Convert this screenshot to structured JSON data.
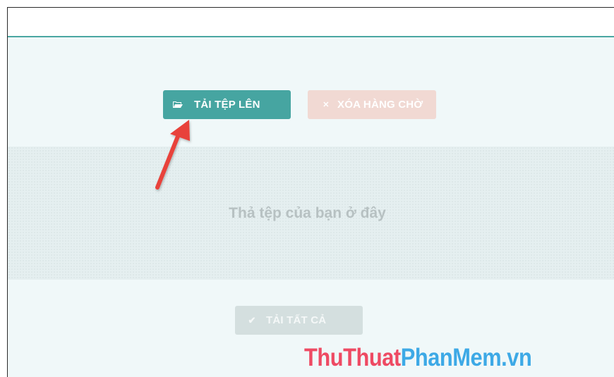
{
  "toolbar": {
    "upload_label": "TẢI TỆP LÊN",
    "clear_label": "XÓA HÀNG CHỜ",
    "clear_icon": "✕",
    "upload_icon": "folder-open-icon"
  },
  "dropzone": {
    "text": "Thả tệp của bạn ở đây"
  },
  "footer": {
    "upload_all_label": "TẢI TẤT CẢ",
    "upload_all_icon": "✔"
  },
  "watermark": {
    "part1": "ThuThuat",
    "part2": "PhanMem.vn"
  },
  "colors": {
    "accent": "#46a5a1",
    "arrow": "#e8423a",
    "clear_button": "#f1d9d3",
    "disabled_button": "#d4dfdf"
  }
}
